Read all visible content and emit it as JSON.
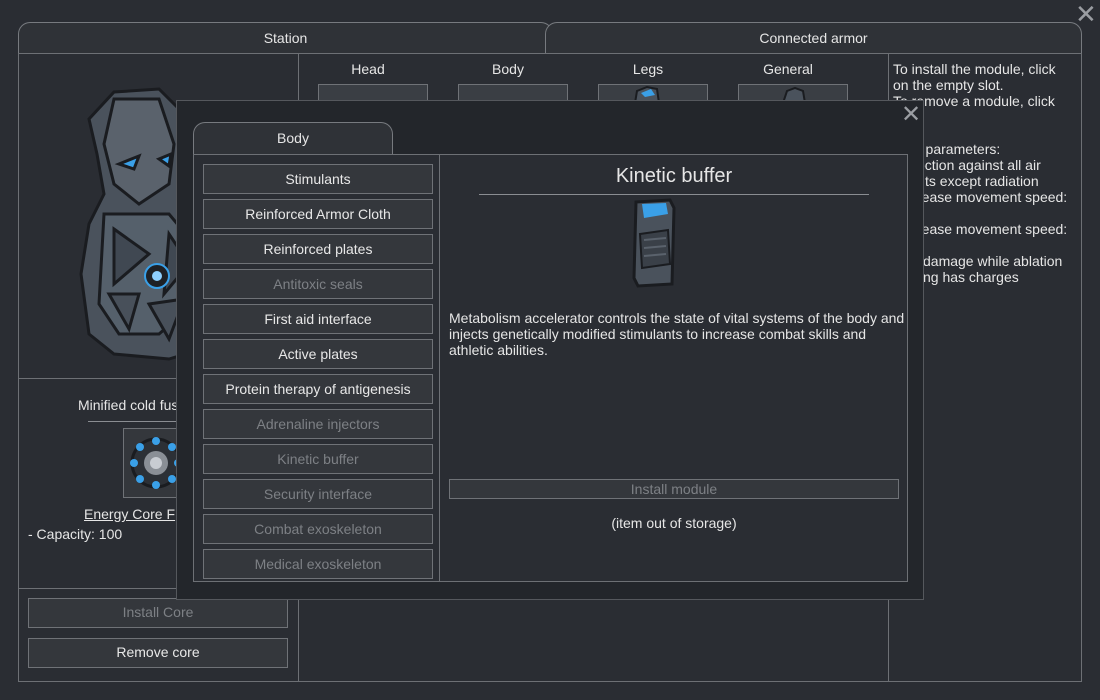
{
  "station": {
    "tab_label": "Station",
    "core_title": "Minified cold fus",
    "core_name": "Energy Core F",
    "capacity": "- Capacity: 100",
    "install_core_label": "Install Core",
    "remove_core_label": "Remove core"
  },
  "armor": {
    "tab_label": "Connected armor",
    "slots": [
      {
        "label": "Head"
      },
      {
        "label": "Body"
      },
      {
        "label": "Legs"
      },
      {
        "label": "General"
      }
    ],
    "info_lines": [
      "To install the module, click",
      "on the empty slot.",
      "To remove a module, click",
      "",
      "",
      "r parameters:",
      "ection against all air",
      "ts except radiation",
      "rease movement speed:",
      "",
      "rease movement speed:",
      "",
      "damage while ablation",
      "ng has charges"
    ]
  },
  "popup": {
    "tab_label": "Body",
    "modules": [
      {
        "label": "Stimulants",
        "enabled": true
      },
      {
        "label": "Reinforced Armor Cloth",
        "enabled": true
      },
      {
        "label": "Reinforced plates",
        "enabled": true
      },
      {
        "label": "Antitoxic seals",
        "enabled": false
      },
      {
        "label": "First aid interface",
        "enabled": true
      },
      {
        "label": "Active plates",
        "enabled": true
      },
      {
        "label": "Protein therapy of antigenesis",
        "enabled": true
      },
      {
        "label": "Adrenaline injectors",
        "enabled": false
      },
      {
        "label": "Kinetic buffer",
        "enabled": false
      },
      {
        "label": "Security interface",
        "enabled": false
      },
      {
        "label": "Combat exoskeleton",
        "enabled": false
      },
      {
        "label": "Medical exoskeleton",
        "enabled": false
      }
    ],
    "detail": {
      "title": "Kinetic buffer",
      "description": "Metabolism accelerator controls the state of vital systems of the body and injects genetically modified stimulants to increase combat skills and athletic abilities.",
      "install_label": "Install module",
      "status": "(item out of storage)"
    }
  },
  "colors": {
    "accent_blue": "#3aa0e8",
    "armor_gray": "#4a525c"
  },
  "icons": {
    "close": "close-icon",
    "popup_close": "close-icon",
    "armor_preview": "armor-figure-icon",
    "core": "fusion-core-icon",
    "module": "kinetic-buffer-icon"
  }
}
